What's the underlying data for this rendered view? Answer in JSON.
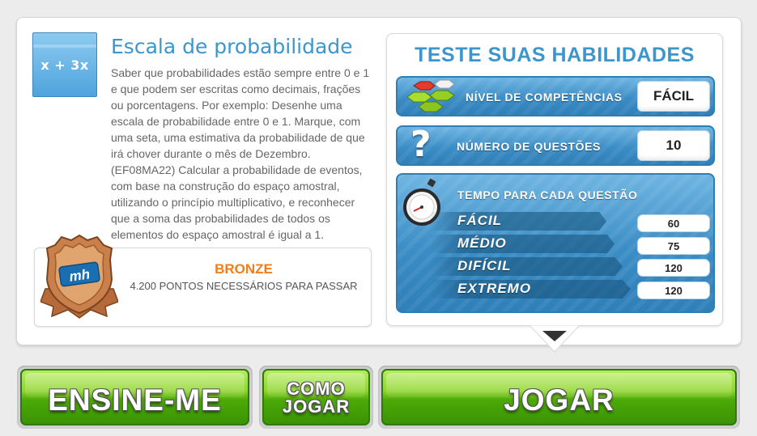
{
  "topic": {
    "icon_text": "x + 3x",
    "title": "Escala de probabilidade",
    "description": "Saber que probabilidades estão sempre entre 0 e 1 e que podem ser escritas como decimais, frações ou porcentagens. Por exemplo: Desenhe uma escala de probabilidade entre 0 e 1. Marque, com uma seta, uma estimativa da probabilidade de que irá chover durante o mês de Dezembro. (EF08MA22) Calcular a probabilidade de eventos, com base na construção do espaço amostral, utilizando o princípio multiplicativo, e reconhecer que a soma das probabilidades de todos os elementos do espaço amostral é igual a 1."
  },
  "badge": {
    "level": "BRONZE",
    "points": "4.200 PONTOS NECESSÁRIOS PARA PASSAR",
    "color": "#f07d1a"
  },
  "skills": {
    "title": "TESTE SUAS HABILIDADES",
    "competence_label": "NÍVEL DE COMPETÊNCIAS",
    "competence_value": "FÁCIL",
    "questions_label": "NÚMERO DE QUESTÕES",
    "questions_value": "10",
    "time_label": "TEMPO PARA CADA QUESTÃO",
    "times": [
      {
        "label": "FÁCIL",
        "value": "60"
      },
      {
        "label": "MÉDIO",
        "value": "75"
      },
      {
        "label": "DIFÍCIL",
        "value": "120"
      },
      {
        "label": "EXTREMO",
        "value": "120"
      }
    ]
  },
  "buttons": {
    "teach": "ENSINE-ME",
    "how_line1": "COMO",
    "how_line2": "JOGAR",
    "play": "JOGAR"
  },
  "colors": {
    "accent_blue": "#3c96ce",
    "button_green": "#4caa07"
  }
}
